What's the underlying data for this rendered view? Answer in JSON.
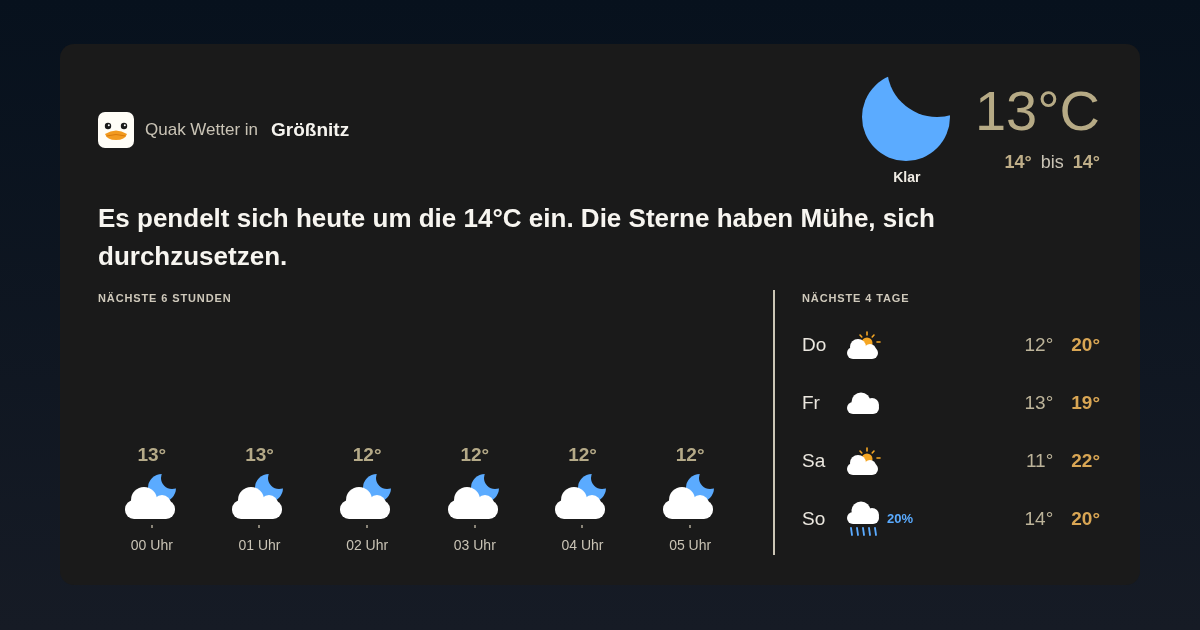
{
  "header": {
    "brand": "Quak Wetter in",
    "location": "Größnitz"
  },
  "current": {
    "kind": "moon",
    "condition": "Klar",
    "temperature": "13°C",
    "low": "14°",
    "range_word": "bis",
    "high": "14°"
  },
  "summary": "Es pendelt sich heute um die 14°C ein. Die Sterne haben Mühe, sich durchzusetzen.",
  "hourly": {
    "title": "NÄCHSTE 6 STUNDEN",
    "hours": [
      {
        "temp": "13°",
        "kind": "cloud-moon",
        "time": "00 Uhr"
      },
      {
        "temp": "13°",
        "kind": "cloud-moon",
        "time": "01 Uhr"
      },
      {
        "temp": "12°",
        "kind": "cloud-moon",
        "time": "02 Uhr"
      },
      {
        "temp": "12°",
        "kind": "cloud-moon",
        "time": "03 Uhr"
      },
      {
        "temp": "12°",
        "kind": "cloud-moon",
        "time": "04 Uhr"
      },
      {
        "temp": "12°",
        "kind": "cloud-moon",
        "time": "05 Uhr"
      }
    ]
  },
  "daily": {
    "title": "NÄCHSTE 4 TAGE",
    "days": [
      {
        "day": "Do",
        "kind": "sun-cloud",
        "low": "12°",
        "high": "20°"
      },
      {
        "day": "Fr",
        "kind": "cloud",
        "low": "13°",
        "high": "19°"
      },
      {
        "day": "Sa",
        "kind": "sun-cloud",
        "low": "11°",
        "high": "22°"
      },
      {
        "day": "So",
        "kind": "rain",
        "precipitation": "20%",
        "low": "14°",
        "high": "20°"
      }
    ]
  }
}
